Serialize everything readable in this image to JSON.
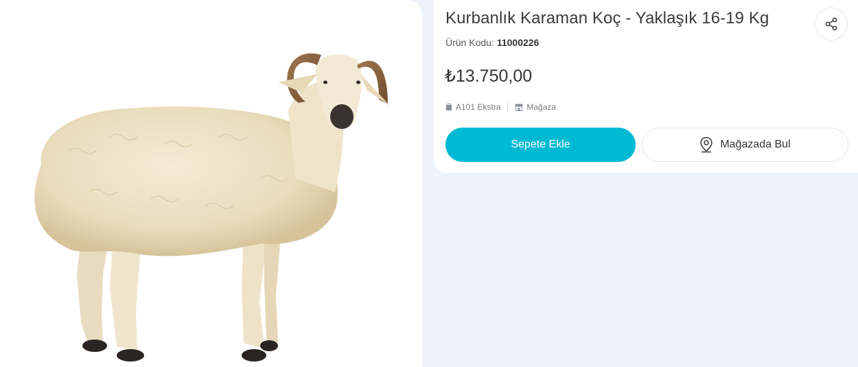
{
  "product": {
    "title": "Kurbanlık Karaman Koç - Yaklaşık 16-19 Kg",
    "code_label": "Ürün Kodu:",
    "code_value": "11000226",
    "price": "₺13.750,00",
    "tags": [
      {
        "icon": "shopping-bag-icon",
        "label": "A101 Ekstra"
      },
      {
        "icon": "store-icon",
        "label": "Mağaza"
      }
    ]
  },
  "actions": {
    "add_to_cart": "Sepete Ekle",
    "find_in_store": "Mağazada Bul",
    "share_icon": "share-icon",
    "location_icon": "location-pin-icon"
  },
  "colors": {
    "accent": "#00bad3",
    "page_background": "#eef2fa",
    "card_background": "#ffffff"
  }
}
